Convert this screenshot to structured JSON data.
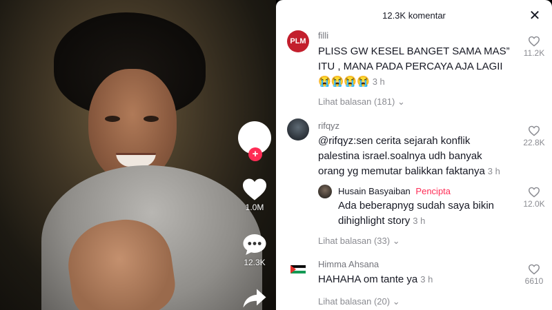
{
  "video": {
    "like_count": "1.0M",
    "comment_count": "12.3K"
  },
  "panel": {
    "title": "12.3K komentar",
    "close_icon": "close-icon"
  },
  "comments": [
    {
      "avatar_text": "PLM",
      "user": "filli",
      "text_line1": "PLISS GW KESEL BANGET SAMA MAS”",
      "text_line2": "ITU , MANA PADA PERCAYA AJA LAGII",
      "emoji": "😭😭😭😭",
      "time": "3 h",
      "likes": "11.2K",
      "replies": "Lihat balasan (181)"
    },
    {
      "user": "rifqyz",
      "text_line1": "@rifqyz:sen cerita sejarah konflik",
      "text_line2": "palestina israel.soalnya udh banyak",
      "text_line3": "orang yg memutar balikkan faktanya",
      "time": "3 h",
      "likes": "22.8K"
    },
    {
      "user": "Husain Basyaiban",
      "badge": "Pencipta",
      "badge_color": "#fe2c55",
      "text_line1": "Ada beberapnyg sudah saya bikin",
      "text_line2": "dihighlight story",
      "time": "3 h",
      "likes": "12.0K",
      "replies": "Lihat balasan (33)"
    },
    {
      "user": "Himma Ahsana",
      "text_line1": "HAHAHA om tante ya",
      "time": "3 h",
      "likes": "6610",
      "replies": "Lihat balasan (20)"
    }
  ],
  "colors": {
    "accent": "#fe2c55",
    "muted_text": "#8a8b91"
  }
}
